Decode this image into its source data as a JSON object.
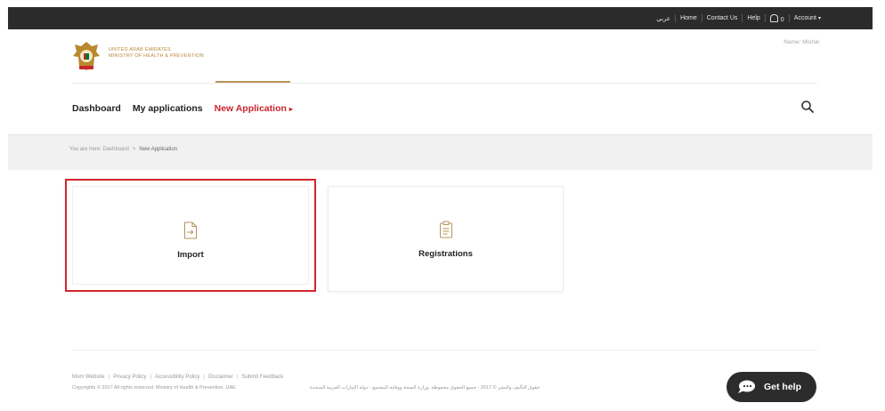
{
  "topbar": {
    "arabic_label": "عربي",
    "home": "Home",
    "contact": "Contact Us",
    "help": "Help",
    "notification_count": "0",
    "account": "Account"
  },
  "header": {
    "ministry_line1": "UNITED ARAB EMIRATES",
    "ministry_line2": "MINISTRY OF HEALTH & PREVENTION",
    "user_name": "Name: Mishal"
  },
  "nav": {
    "dashboard": "Dashboard",
    "my_applications": "My applications",
    "new_application": "New Application",
    "new_application_arrow": "▸"
  },
  "breadcrumb": {
    "prefix": "You are here:",
    "parent": "Dashboard",
    "separator": ">",
    "current": "New Application"
  },
  "cards": [
    {
      "label": "Import",
      "icon": "import-icon",
      "selected": true
    },
    {
      "label": "Registrations",
      "icon": "clipboard-icon",
      "selected": false
    }
  ],
  "footer": {
    "links": [
      "Mom Website",
      "Privacy Policy",
      "Accessibility Policy",
      "Disclaimer",
      "Submit Feedback"
    ],
    "copyright": "Copyrights © 2017 All rights reserved. Ministry of Health & Prevention, UAE",
    "copyright_ar": "حقوق التأليف والنشر © 2017 - جميع الحقوق محفوظة. وزارة الصحة ووقاية المجتمع - دولة الإمارات العربية المتحدة"
  },
  "gethelp": {
    "label": "Get help"
  },
  "colors": {
    "topbar": "#2b2b2b",
    "accent_red": "#c8262d",
    "gold": "#b6935b",
    "selection_border": "#d3262c"
  }
}
